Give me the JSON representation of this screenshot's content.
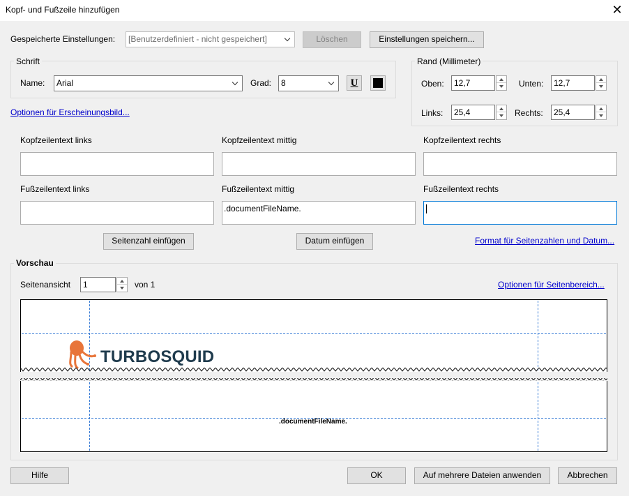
{
  "window": {
    "title": "Kopf- und Fußzeile hinzufügen"
  },
  "saved_settings": {
    "label": "Gespeicherte Einstellungen:",
    "value": "[Benutzerdefiniert - nicht gespeichert]",
    "delete_label": "Löschen",
    "save_label": "Einstellungen speichern..."
  },
  "font": {
    "group_label": "Schrift",
    "name_label": "Name:",
    "name_value": "Arial",
    "size_label": "Grad:",
    "size_value": "8",
    "underline_glyph": "U",
    "color": "#000000"
  },
  "margin": {
    "group_label": "Rand (Millimeter)",
    "top_label": "Oben:",
    "top_value": "12,7",
    "bottom_label": "Unten:",
    "bottom_value": "12,7",
    "left_label": "Links:",
    "left_value": "25,4",
    "right_label": "Rechts:",
    "right_value": "25,4"
  },
  "appearance_link": "Optionen für Erscheinungsbild...",
  "header": {
    "left_label": "Kopfzeilentext links",
    "left_value": "",
    "center_label": "Kopfzeilentext mittig",
    "center_value": "",
    "right_label": "Kopfzeilentext rechts",
    "right_value": ""
  },
  "footer": {
    "left_label": "Fußzeilentext links",
    "left_value": "",
    "center_label": "Fußzeilentext mittig",
    "center_value": ".documentFileName.",
    "right_label": "Fußzeilentext rechts",
    "right_value": ""
  },
  "insert": {
    "page_number_label": "Seitenzahl einfügen",
    "date_label": "Datum einfügen",
    "format_link": "Format für Seitenzahlen und Datum..."
  },
  "preview": {
    "group_label": "Vorschau",
    "page_view_label": "Seitenansicht",
    "page_value": "1",
    "of_label": "von 1",
    "page_range_link": "Optionen für Seitenbereich...",
    "logo_text": "TURBOSQUID",
    "logo_color": "#e8753a",
    "footer_text": ".documentFileName."
  },
  "buttons": {
    "help": "Hilfe",
    "ok": "OK",
    "apply_multiple": "Auf mehrere Dateien anwenden",
    "cancel": "Abbrechen"
  }
}
